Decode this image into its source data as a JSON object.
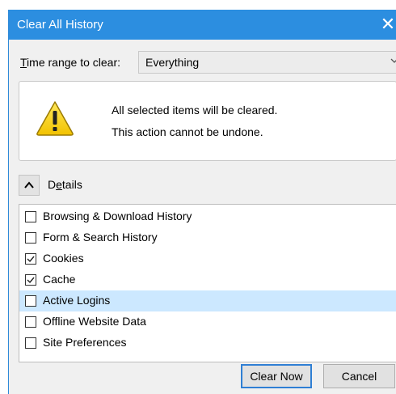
{
  "dialog": {
    "title": "Clear All History",
    "close_glyph": "✕"
  },
  "time_range": {
    "label_accel": "T",
    "label_rest": "ime range to clear:",
    "value": "Everything"
  },
  "warning": {
    "icon": "warning-triangle-icon",
    "line1": "All selected items will be cleared.",
    "line2": "This action cannot be undone."
  },
  "details": {
    "label_pre": "D",
    "label_accel": "e",
    "label_post": "tails",
    "expanded": true
  },
  "items": [
    {
      "label": "Browsing & Download History",
      "checked": false
    },
    {
      "label": "Form & Search History",
      "checked": false
    },
    {
      "label": "Cookies",
      "checked": true
    },
    {
      "label": "Cache",
      "checked": true
    },
    {
      "label": "Active Logins",
      "checked": false,
      "highlighted": true
    },
    {
      "label": "Offline Website Data",
      "checked": false
    },
    {
      "label": "Site Preferences",
      "checked": false
    }
  ],
  "buttons": {
    "clear_now": "Clear Now",
    "cancel": "Cancel"
  },
  "colors": {
    "titlebar": "#2c8ee0",
    "highlight": "#cce8ff",
    "primary_border": "#2f7fd4"
  }
}
